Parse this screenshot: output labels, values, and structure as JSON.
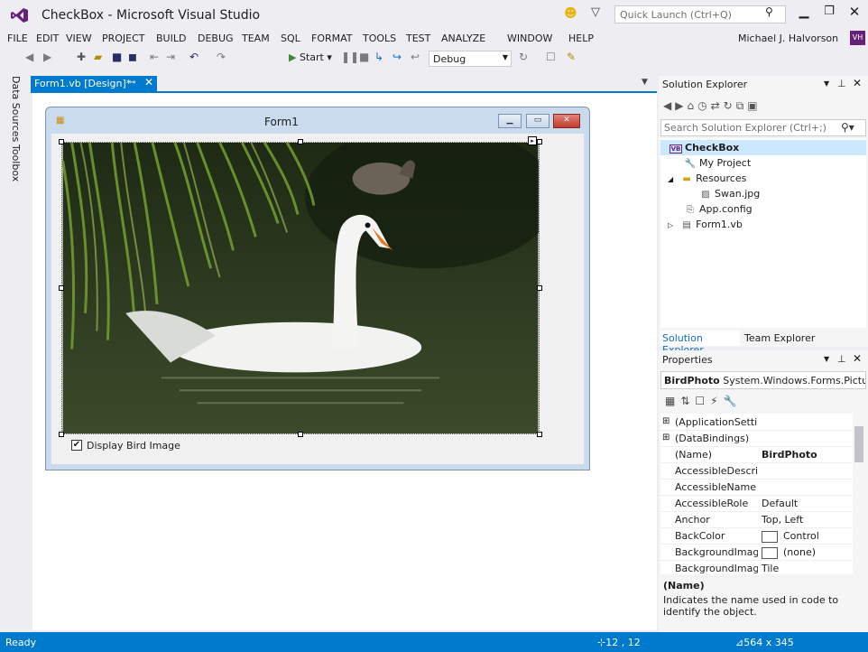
{
  "window": {
    "title": "CheckBox - Microsoft Visual Studio",
    "quick_launch_placeholder": "Quick Launch (Ctrl+Q)"
  },
  "menu": [
    "FILE",
    "EDIT",
    "VIEW",
    "PROJECT",
    "BUILD",
    "DEBUG",
    "TEAM",
    "SQL",
    "FORMAT",
    "TOOLS",
    "TEST",
    "ANALYZE",
    "WINDOW",
    "HELP"
  ],
  "user": {
    "name": "Michael J. Halvorson",
    "initials": "VH",
    "badge_color": "#68217a"
  },
  "toolbar": {
    "start_label": "Start",
    "configuration": "Debug"
  },
  "left_tabs": [
    "Data Sources",
    "Toolbox"
  ],
  "document_tab": {
    "label": "Form1.vb [Design]*"
  },
  "form": {
    "title": "Form1",
    "checkbox_label": "Display Bird Image",
    "checkbox_checked": true
  },
  "solution_explorer": {
    "title": "Solution Explorer",
    "search_placeholder": "Search Solution Explorer (Ctrl+;)",
    "tree": [
      {
        "label": "CheckBox",
        "icon": "vb-project-icon",
        "bold": true
      },
      {
        "label": "My Project",
        "icon": "wrench-icon"
      },
      {
        "label": "Resources",
        "icon": "folder-icon",
        "expanded": true
      },
      {
        "label": "Swan.jpg",
        "icon": "image-file-icon"
      },
      {
        "label": "App.config",
        "icon": "config-file-icon"
      },
      {
        "label": "Form1.vb",
        "icon": "form-file-icon",
        "collapsed": true
      }
    ],
    "tabs": [
      "Solution Explorer",
      "Team Explorer"
    ]
  },
  "properties": {
    "title": "Properties",
    "object_name": "BirdPhoto",
    "object_type": "System.Windows.Forms.PictureBox",
    "rows": [
      {
        "name": "(ApplicationSettings)",
        "value": "",
        "expander": "⊞"
      },
      {
        "name": "(DataBindings)",
        "value": "",
        "expander": "⊞"
      },
      {
        "name": "(Name)",
        "value": "BirdPhoto",
        "bold": true
      },
      {
        "name": "AccessibleDescription",
        "value": ""
      },
      {
        "name": "AccessibleName",
        "value": ""
      },
      {
        "name": "AccessibleRole",
        "value": "Default"
      },
      {
        "name": "Anchor",
        "value": "Top, Left"
      },
      {
        "name": "BackColor",
        "value": "Control",
        "swatch": true
      },
      {
        "name": "BackgroundImage",
        "value": "(none)",
        "swatch": true
      },
      {
        "name": "BackgroundImageLayout",
        "value": "Tile"
      }
    ],
    "description_name": "(Name)",
    "description_text": "Indicates the name used in code to identify the object."
  },
  "status": {
    "ready": "Ready",
    "position": "12 , 12",
    "size": "564 x 345"
  }
}
